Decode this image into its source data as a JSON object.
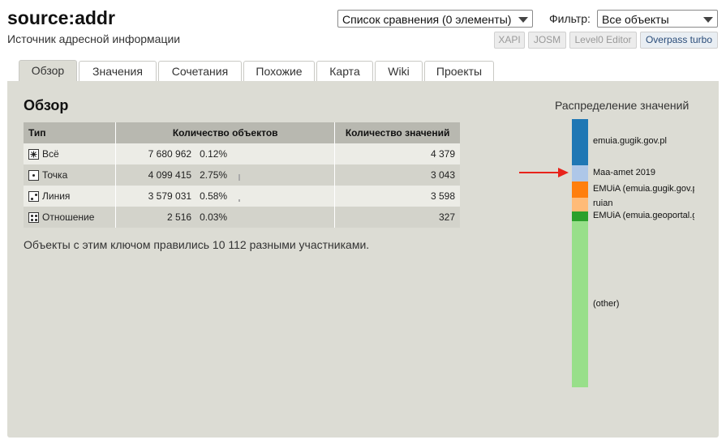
{
  "header": {
    "title": "source:addr",
    "subtitle": "Источник адресной информации",
    "comparison_select": "Список сравнения (0 элементы)",
    "filter_label": "Фильтр:",
    "filter_value": "Все объекты",
    "tools": [
      "XAPI",
      "JOSM",
      "Level0 Editor",
      "Overpass turbo"
    ]
  },
  "tabs": [
    "Обзор",
    "Значения",
    "Сочетания",
    "Похожие",
    "Карта",
    "Wiki",
    "Проекты"
  ],
  "active_tab": "Обзор",
  "overview": {
    "title": "Обзор",
    "table": {
      "headers": [
        "Тип",
        "Количество объектов",
        "Количество значений"
      ],
      "rows": [
        {
          "type": "Всё",
          "icon": "all-icon",
          "count": "7 680 962",
          "percent": "0.12%",
          "percent_value": 0.12,
          "values": "4 379"
        },
        {
          "type": "Точка",
          "icon": "node-icon",
          "count": "4 099 415",
          "percent": "2.75%",
          "percent_value": 2.75,
          "values": "3 043"
        },
        {
          "type": "Линия",
          "icon": "way-icon",
          "count": "3 579 031",
          "percent": "0.58%",
          "percent_value": 0.58,
          "values": "3 598"
        },
        {
          "type": "Отношение",
          "icon": "relation-icon",
          "count": "2 516",
          "percent": "0.03%",
          "percent_value": 0.03,
          "values": "327"
        }
      ]
    },
    "note": "Объекты с этим ключом правились 10 112 разными участниками."
  },
  "distribution": {
    "title": "Распределение значений",
    "segments": [
      {
        "label": "emuia.gugik.gov.pl",
        "color": "#1f77b4",
        "fraction": 0.171
      },
      {
        "label": "Maa-amet 2019",
        "color": "#aec7e8",
        "fraction": 0.062
      },
      {
        "label": "EMUiA (emuia.gugik.gov.pl)",
        "color": "#ff7f0e",
        "fraction": 0.06
      },
      {
        "label": "ruian",
        "color": "#ffbb78",
        "fraction": 0.05
      },
      {
        "label": "EMUiA (emuia.geoportal.gov.pl)",
        "color": "#2ca02c",
        "fraction": 0.038
      },
      {
        "label": "(other)",
        "color": "#98df8a",
        "fraction": 0.619
      }
    ]
  }
}
